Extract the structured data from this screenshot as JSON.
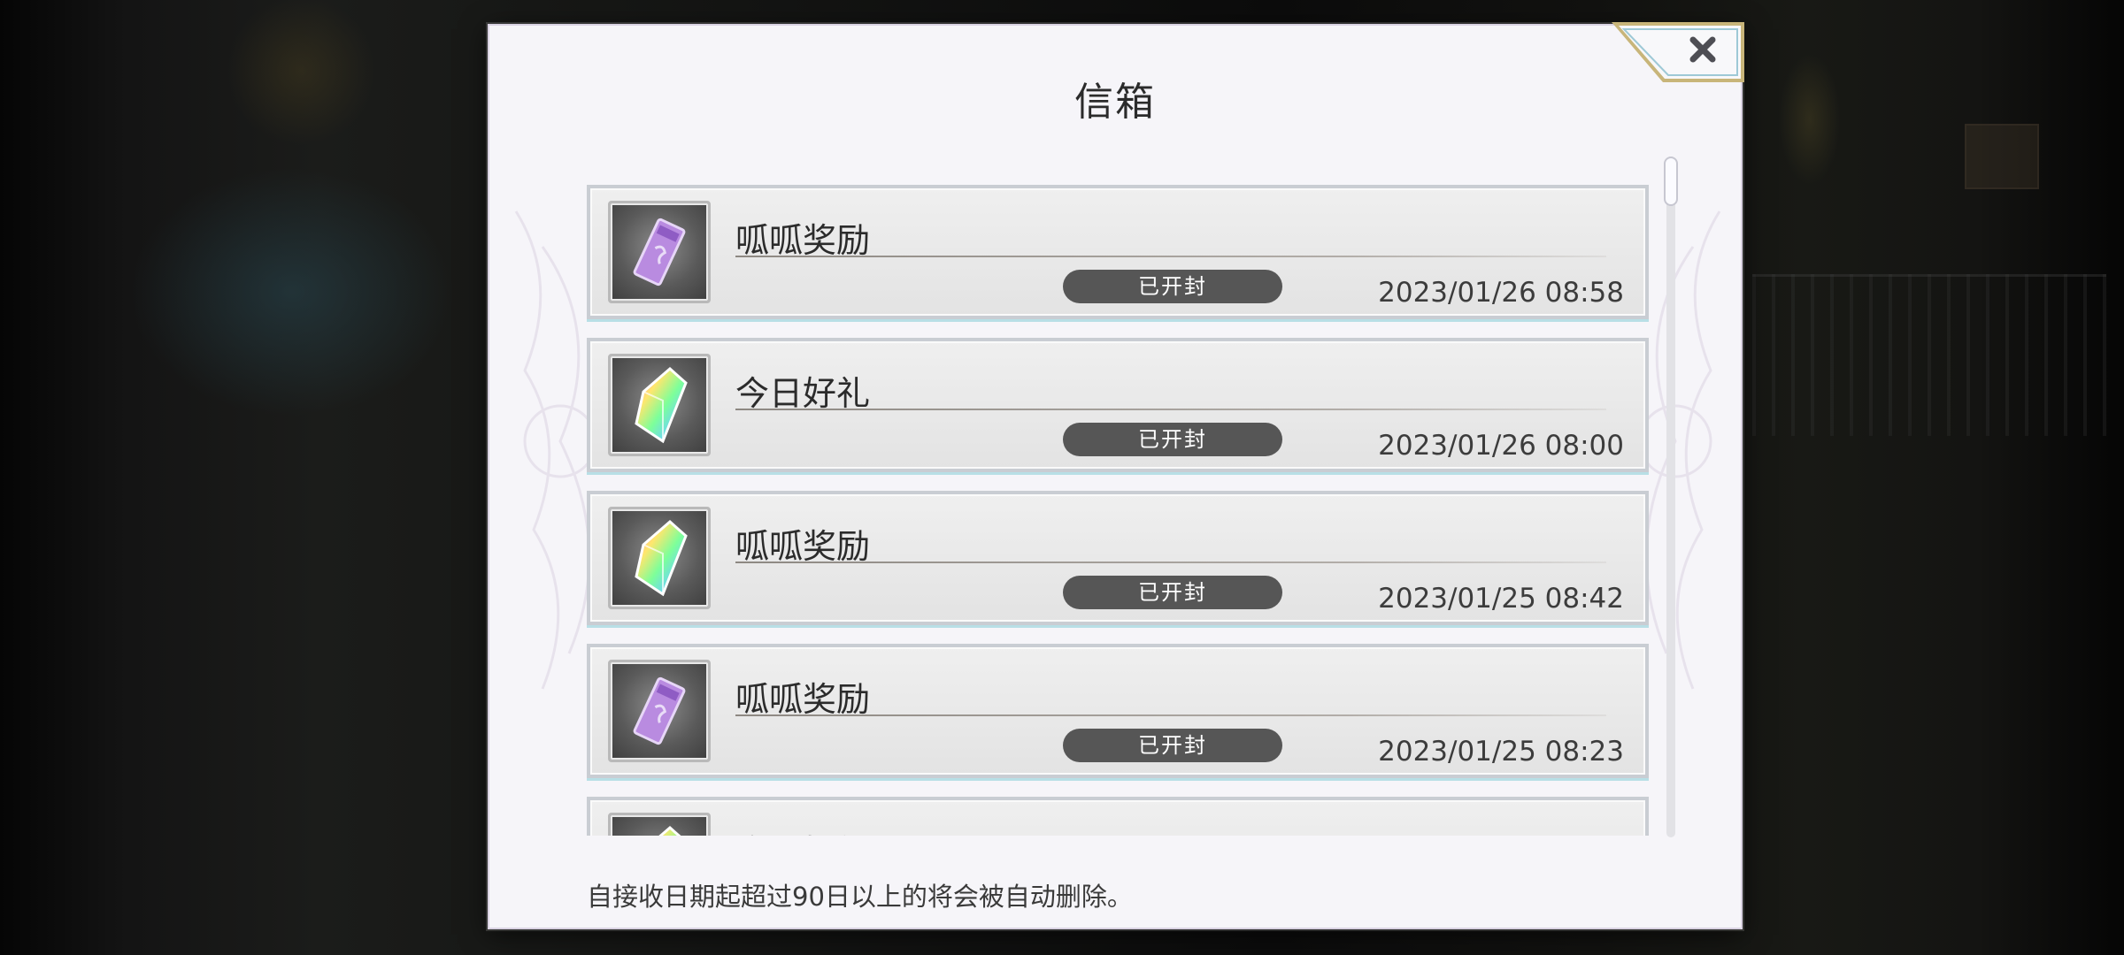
{
  "dialog": {
    "title": "信箱",
    "close_icon": "close-x-icon",
    "notice": "自接收日期起超过90日以上的将会被自动删除。"
  },
  "mails": [
    {
      "title": "呱呱奖励",
      "status": "已开封",
      "time": "2023/01/26 08:58",
      "icon": "ticket-icon"
    },
    {
      "title": "今日好礼",
      "status": "已开封",
      "time": "2023/01/26 08:00",
      "icon": "rainbow-crystal-icon"
    },
    {
      "title": "呱呱奖励",
      "status": "已开封",
      "time": "2023/01/25 08:42",
      "icon": "rainbow-crystal-icon"
    },
    {
      "title": "呱呱奖励",
      "status": "已开封",
      "time": "2023/01/25 08:23",
      "icon": "ticket-icon"
    },
    {
      "title": "今日好礼",
      "status": "",
      "time": "",
      "icon": "rainbow-crystal-icon"
    }
  ],
  "colors": {
    "status_badge": "#565656",
    "item_border": "#c9cdd3",
    "frame_gold": "#c8b57a"
  }
}
